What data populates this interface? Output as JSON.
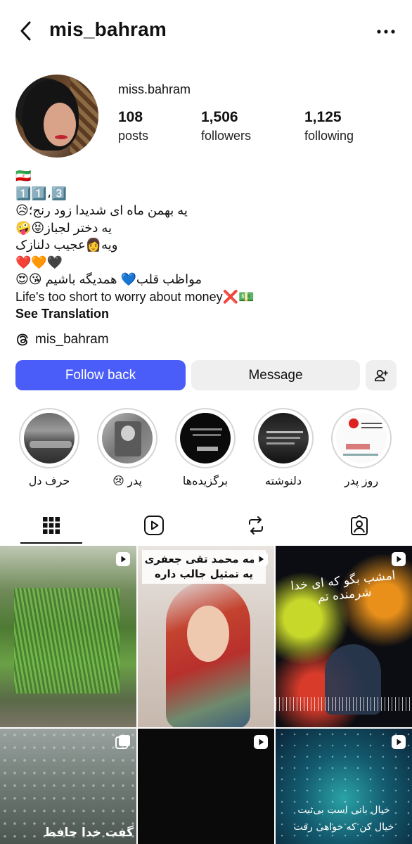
{
  "header": {
    "username": "mis_bahram"
  },
  "profile": {
    "display_name": "miss.bahram",
    "stats": [
      {
        "value": "108",
        "label": "posts"
      },
      {
        "value": "1,506",
        "label": "followers"
      },
      {
        "value": "1,125",
        "label": "following"
      }
    ]
  },
  "bio": {
    "lines": [
      "🇮🇷",
      "1️⃣1️⃣،3️⃣",
      "یه بهمن ماه ای شدیدا زود رنج؛😥",
      "یه دختر لجباز😝🤪",
      "ویه👩عجیب دلنازک",
      "❤️🧡🖤",
      "مواظب قلب💙 همدیگه باشیم 😘😍",
      "Life's too short to worry about money❌💵"
    ],
    "see_translation": "See Translation",
    "threads_handle": "mis_bahram"
  },
  "actions": {
    "follow_back": "Follow back",
    "message": "Message"
  },
  "highlights": [
    {
      "label": "حرف دل"
    },
    {
      "label": "پدر 😢"
    },
    {
      "label": "برگزیده‌ها"
    },
    {
      "label": "دلنوشته"
    },
    {
      "label": "روز پدر"
    }
  ],
  "grid": {
    "tile2_overlay": [
      "لامه محمد تقی جعفری",
      "یه تمثیل جالب داره"
    ],
    "tile3_overlay": "امشب بگو که ای خدا شرمنده تم",
    "tile4_overlay": "گفت خدا حافظ",
    "tile6_overlay": [
      "خیال بانی است بی‌ثبت",
      "خیال کن که خواهی رفت"
    ]
  },
  "icons": {
    "back": "chevron-left-icon",
    "more": "more-horizontal-icon",
    "threads": "threads-icon",
    "add_user": "add-user-icon",
    "tab_grid": "grid-icon",
    "tab_reels": "reels-icon",
    "tab_reposts": "repost-icon",
    "tab_tagged": "tagged-icon"
  },
  "colors": {
    "follow_button": "#4a5df9",
    "secondary_button": "#efefef"
  }
}
